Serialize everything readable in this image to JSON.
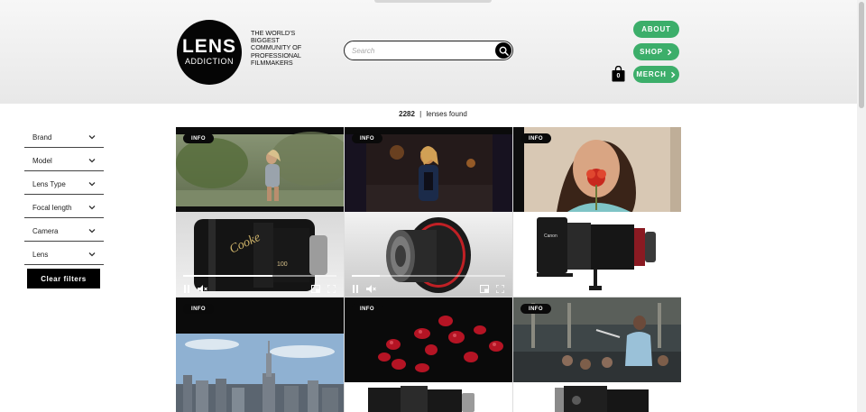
{
  "brand": {
    "logo_big": "LENS",
    "logo_small": "ADDICTION",
    "tagline": "THE WORLD'S BIGGEST COMMUNITY OF PROFESSIONAL FILMMAKERS"
  },
  "search": {
    "placeholder": "Search",
    "icon": "search-icon"
  },
  "nav": {
    "about": "ABOUT",
    "shop": "SHOP",
    "merch": "MERCH",
    "cart_count": "0"
  },
  "results": {
    "count": "2282",
    "separator": "|",
    "label": "lenses found"
  },
  "filters": {
    "items": [
      {
        "label": "Brand"
      },
      {
        "label": "Model"
      },
      {
        "label": "Lens Type"
      },
      {
        "label": "Focal length"
      },
      {
        "label": "Camera"
      },
      {
        "label": "Lens"
      }
    ],
    "clear_label": "Clear filters"
  },
  "cards": {
    "badge": "INFO",
    "items": [
      {
        "id": "card-1",
        "thumb": "runner-park-scene",
        "product": "cooke-anamorphic-lens",
        "video_progress": 0.58
      },
      {
        "id": "card-2",
        "thumb": "woman-night-street",
        "product": "angenieux-prime-red-lens",
        "video_progress": 0.18
      },
      {
        "id": "card-3",
        "thumb": "woman-red-flower",
        "product": "canon-cine-zoom-lens"
      },
      {
        "id": "card-4",
        "thumb": "new-york-skyline"
      },
      {
        "id": "card-5",
        "thumb": "red-pomegranate-seeds"
      },
      {
        "id": "card-6",
        "thumb": "conductor-orchestra"
      }
    ]
  },
  "colors": {
    "accent": "#3cae6a",
    "dark": "#000000",
    "header_bg": "#eeeeee"
  }
}
